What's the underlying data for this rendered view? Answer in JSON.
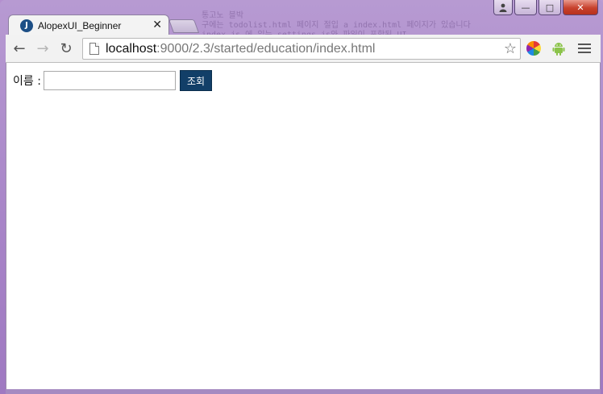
{
  "window": {
    "controls": {
      "user_icon": "user-icon",
      "minimize_glyph": "—",
      "maximize_glyph": "□",
      "close_glyph": "✕"
    }
  },
  "background_text": [
    "통고노 블박",
    "구에는 todolist.html  페이지 절입 a index.html  페이지가 있습니다",
    "index.js 에 있는 settings.js와 파일이 포함된 UI",
    ""
  ],
  "tab": {
    "title": "AlopexUI_Beginner",
    "favicon": "alopex-logo-icon",
    "favicon_letter": "J",
    "close_glyph": "✕"
  },
  "toolbar": {
    "back_glyph": "←",
    "forward_glyph": "→",
    "reload_glyph": "↻",
    "url_host": "localhost",
    "url_path": ":9000/2.3/started/education/index.html",
    "star_glyph": "☆",
    "android_glyph": "⬟"
  },
  "form": {
    "name_label": "이름 :",
    "name_value": "",
    "search_button": "조회"
  },
  "colors": {
    "button_bg": "#123f68",
    "frame": "#a783c7"
  }
}
